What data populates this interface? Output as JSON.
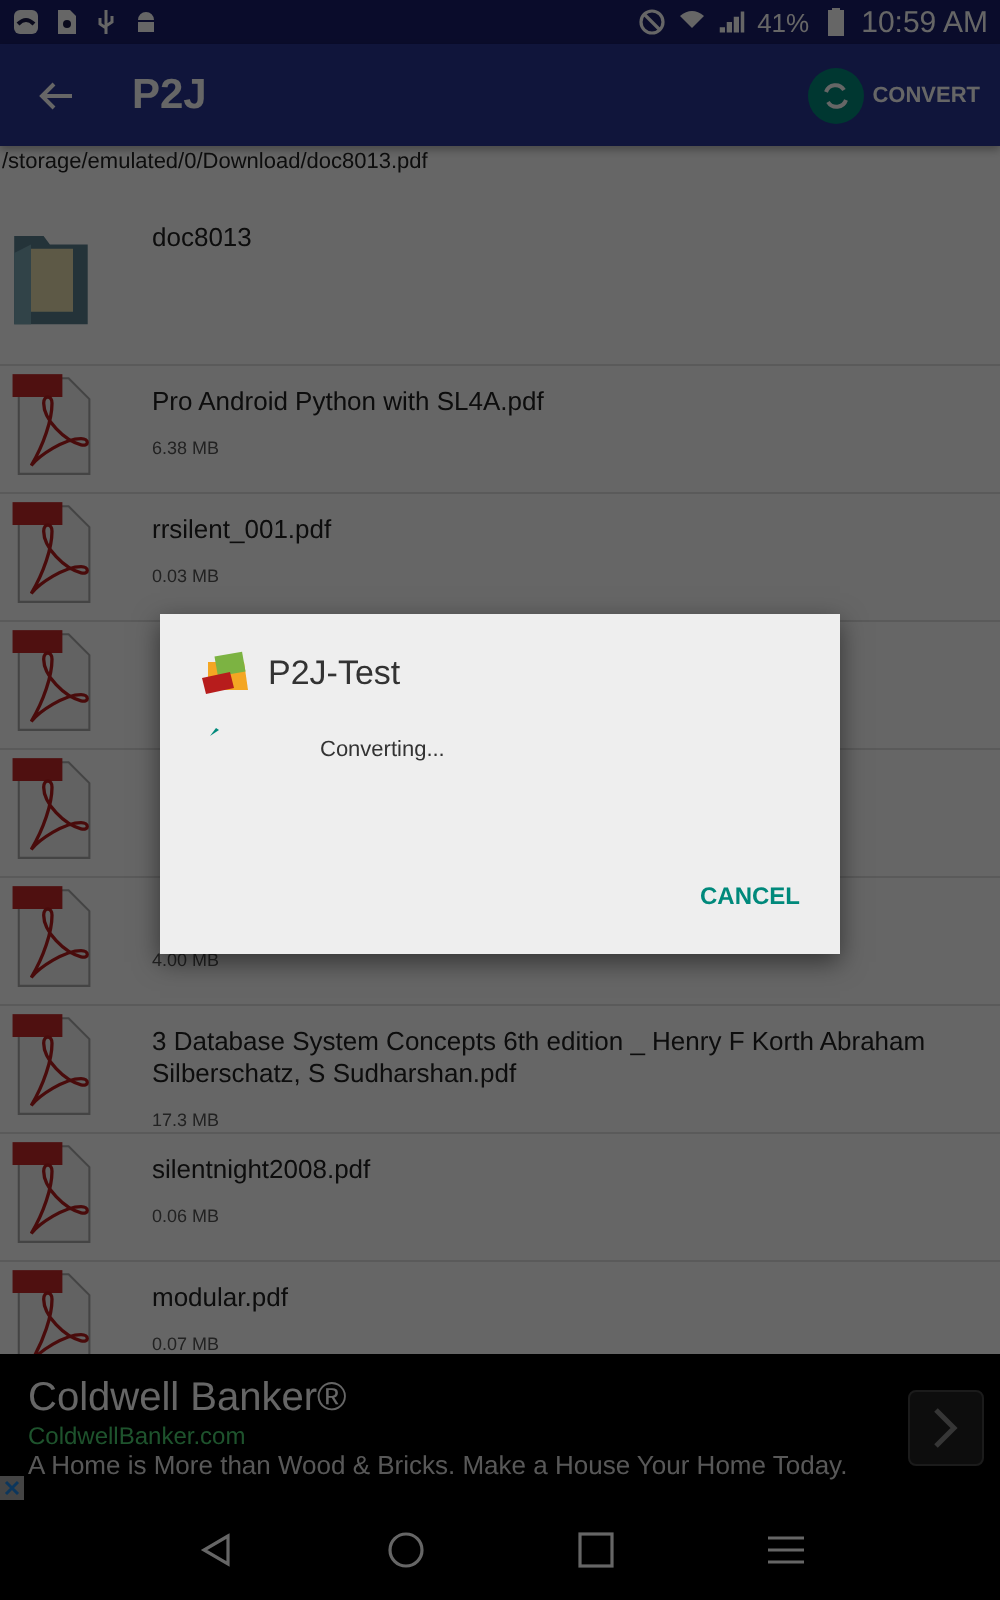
{
  "status_bar": {
    "battery": "41%",
    "time": "10:59 AM"
  },
  "toolbar": {
    "title": "P2J",
    "action": "CONVERT"
  },
  "path": "/storage/emulated/0/Download/doc8013.pdf",
  "files": [
    {
      "kind": "folder",
      "name": "doc8013"
    },
    {
      "kind": "pdf",
      "name": "Pro Android Python with SL4A.pdf",
      "size": "6.38 MB"
    },
    {
      "kind": "pdf",
      "name": "rrsilent_001.pdf",
      "size": "0.03 MB"
    },
    {
      "kind": "pdf"
    },
    {
      "kind": "pdf"
    },
    {
      "kind": "pdf",
      "size": "4.00 MB"
    },
    {
      "kind": "pdf",
      "name": "3 Database System Concepts 6th edition _ Henry F Korth Abraham Silberschatz, S Sudharshan.pdf",
      "size": "17.3 MB"
    },
    {
      "kind": "pdf",
      "name": "silentnight2008.pdf",
      "size": "0.06 MB"
    },
    {
      "kind": "pdf",
      "name": "modular.pdf",
      "size": "0.07 MB"
    }
  ],
  "dialog": {
    "title": "P2J-Test",
    "message": "Converting...",
    "button": "CANCEL"
  },
  "ad": {
    "title": "Coldwell Banker®",
    "url": "ColdwellBanker.com",
    "text": "A Home is More than Wood & Bricks. Make a House Your Home Today."
  }
}
